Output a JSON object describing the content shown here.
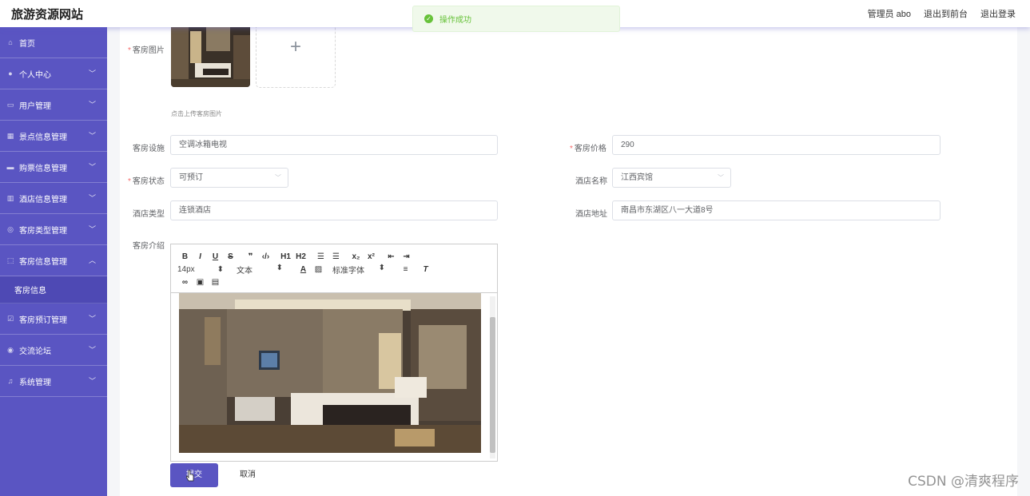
{
  "header": {
    "site_title": "旅游资源网站",
    "admin_label": "管理员 abo",
    "back_frontend": "退出到前台",
    "logout": "退出登录"
  },
  "toast": {
    "message": "操作成功",
    "type": "success"
  },
  "sidebar": {
    "items": [
      {
        "label": "首页",
        "icon": "home-icon"
      },
      {
        "label": "个人中心",
        "icon": "user-icon"
      },
      {
        "label": "用户管理",
        "icon": "chat-icon"
      },
      {
        "label": "景点信息管理",
        "icon": "grid-icon"
      },
      {
        "label": "购票信息管理",
        "icon": "ticket-icon"
      },
      {
        "label": "酒店信息管理",
        "icon": "building-icon"
      },
      {
        "label": "客房类型管理",
        "icon": "circle-icon"
      },
      {
        "label": "客房信息管理",
        "icon": "frame-icon"
      },
      {
        "label": "客房预订管理",
        "icon": "check-icon"
      },
      {
        "label": "交流论坛",
        "icon": "compass-icon"
      },
      {
        "label": "系统管理",
        "icon": "mic-icon"
      }
    ],
    "sub_item": "客房信息"
  },
  "form": {
    "image_label": "客房图片",
    "upload_tip": "点击上传客房图片",
    "facility_label": "客房设施",
    "facility_value": "空调冰箱电视",
    "price_label": "客房价格",
    "price_value": "290",
    "status_label": "客房状态",
    "status_value": "可预订",
    "hotel_name_label": "酒店名称",
    "hotel_name_value": "江西宾馆",
    "hotel_type_label": "酒店类型",
    "hotel_type_value": "连锁酒店",
    "hotel_address_label": "酒店地址",
    "hotel_address_value": "南昌市东湖区八一大道8号",
    "intro_label": "客房介绍"
  },
  "editor_toolbar": {
    "font_size": "14px",
    "paragraph": "文本",
    "font_family": "标准字体",
    "buttons_row1": [
      "B",
      "I",
      "U",
      "S",
      "❞",
      "‹/›",
      "H1",
      "H2",
      "☰",
      "☰",
      "x₂",
      "x²",
      "⇤",
      "⇥"
    ]
  },
  "actions": {
    "submit": "提交",
    "cancel": "取消"
  },
  "watermark": "CSDN @清爽程序",
  "colors": {
    "primary": "#5a55c2",
    "success": "#67c23a",
    "required": "#f56c6c"
  }
}
